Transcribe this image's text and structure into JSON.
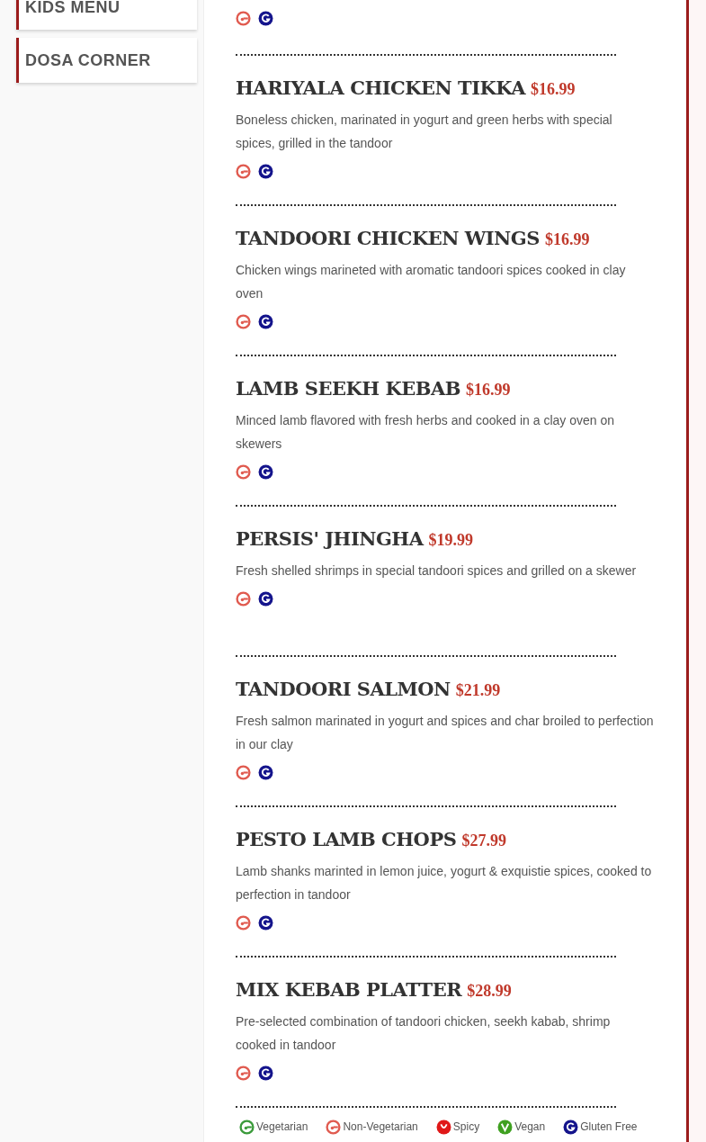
{
  "sidebar": {
    "items": [
      {
        "label": "KIDS MENU"
      },
      {
        "label": "DOSA CORNER"
      }
    ]
  },
  "top_item": {
    "icons": [
      {
        "kind": "non_veg"
      },
      {
        "kind": "gluten_free"
      }
    ]
  },
  "items": [
    {
      "name": "HARIYALA CHICKEN TIKKA",
      "price": "$16.99",
      "description": "Boneless chicken, marinated in yogurt and green herbs with special spices, grilled in the tandoor",
      "icons": [
        {
          "kind": "non_veg"
        },
        {
          "kind": "gluten_free"
        }
      ]
    },
    {
      "name": "TANDOORI CHICKEN WINGS",
      "price": "$16.99",
      "description": "Chicken wings marineted with aromatic tandoori spices cooked in clay oven",
      "icons": [
        {
          "kind": "non_veg"
        },
        {
          "kind": "gluten_free"
        }
      ]
    },
    {
      "name": "LAMB SEEKH KEBAB",
      "price": "$16.99",
      "description": "Minced lamb flavored with fresh herbs and cooked in a clay oven on skewers",
      "icons": [
        {
          "kind": "non_veg"
        },
        {
          "kind": "gluten_free"
        }
      ]
    },
    {
      "name": "PERSIS' JHINGHA",
      "price": "$19.99",
      "description": "Fresh shelled shrimps in special tandoori spices and grilled on a skewer",
      "icons": [
        {
          "kind": "non_veg"
        },
        {
          "kind": "gluten_free"
        }
      ]
    },
    {
      "name": "TANDOORI SALMON",
      "price": "$21.99",
      "description": "Fresh salmon marinated in yogurt and spices and char broiled to perfection in our clay",
      "icons": [
        {
          "kind": "non_veg"
        },
        {
          "kind": "gluten_free"
        }
      ]
    },
    {
      "name": "PESTO LAMB CHOPS",
      "price": "$27.99",
      "description": "Lamb shanks marinted in lemon juice, yogurt & exquistie spices, cooked to perfection in tandoor",
      "icons": [
        {
          "kind": "non_veg"
        },
        {
          "kind": "gluten_free"
        }
      ]
    },
    {
      "name": "MIX KEBAB PLATTER",
      "price": "$28.99",
      "description": "Pre-selected combination of tandoori chicken, seekh kabab, shrimp cooked in tandoor",
      "icons": [
        {
          "kind": "non_veg"
        },
        {
          "kind": "gluten_free"
        }
      ]
    }
  ],
  "legend": [
    {
      "kind": "veg",
      "label": "Vegetarian"
    },
    {
      "kind": "non_veg",
      "label": "Non-Vegetarian"
    },
    {
      "kind": "spicy",
      "label": "Spicy"
    },
    {
      "kind": "vegan",
      "label": "Vegan"
    },
    {
      "kind": "gluten_free",
      "label": "Gluten Free"
    }
  ]
}
